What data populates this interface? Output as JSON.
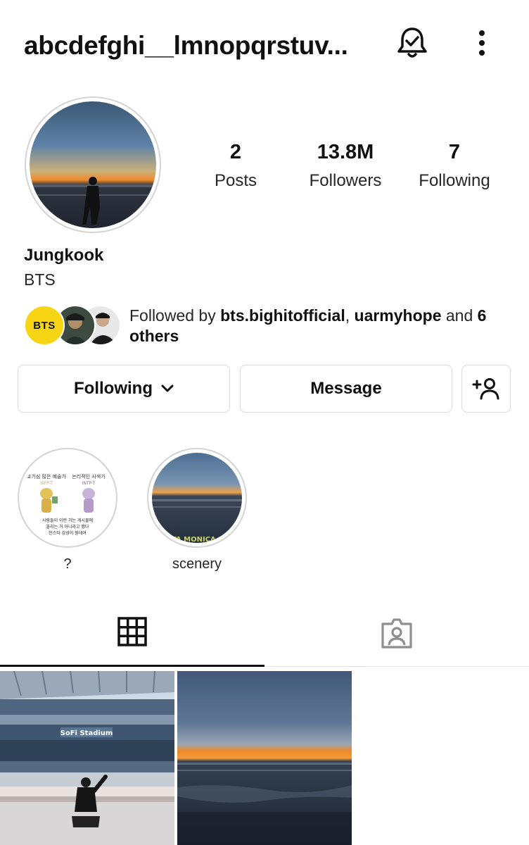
{
  "header": {
    "username": "abcdefghi__lmnopqrstuv...",
    "bell_icon": "bell-check-icon",
    "menu_icon": "more-vertical-icon"
  },
  "profile": {
    "avatar_icon": "sunset-silhouette-avatar",
    "name": "Jungkook",
    "bio": "BTS",
    "stats": [
      {
        "value": "2",
        "label": "Posts"
      },
      {
        "value": "13.8M",
        "label": "Followers"
      },
      {
        "value": "7",
        "label": "Following"
      }
    ]
  },
  "followed_by": {
    "prefix": "Followed by ",
    "user1": "bts.bighitofficial",
    "sep": ", ",
    "user2": "uarmyhope",
    "middle": " and ",
    "others": "6 others",
    "bts_badge": "BTS"
  },
  "actions": {
    "following_label": "Following",
    "message_label": "Message",
    "add_user_icon": "add-user-icon"
  },
  "highlights": [
    {
      "label": "?",
      "cover": {
        "left_title": "호기심 많은 예술가",
        "left_type": "ISFP-T",
        "right_title": "논리적인 사색가",
        "right_type": "INTP-T",
        "caption_line1": "사람들이 이런 거는 게시물에",
        "caption_line2": "올리는 거 아니라고 했다",
        "caption_line3": "인스타 감성이 뭔데여"
      }
    },
    {
      "label": "scenery",
      "cover": {
        "location": "SANTA MONICA, CALI"
      }
    }
  ],
  "tabs": [
    {
      "name": "grid",
      "icon": "grid-icon",
      "active": true
    },
    {
      "name": "tagged",
      "icon": "tagged-person-icon",
      "active": false
    }
  ],
  "posts": [
    {
      "icon": "stadium-photo",
      "sign": "SoFi Stadium"
    },
    {
      "icon": "sunset-beach-photo"
    }
  ],
  "colors": {
    "text_primary": "#111111",
    "text_secondary": "#262626",
    "border": "#dbdbdb",
    "bts_yellow": "#f7d515",
    "sunset_orange": "#f08a2a"
  }
}
